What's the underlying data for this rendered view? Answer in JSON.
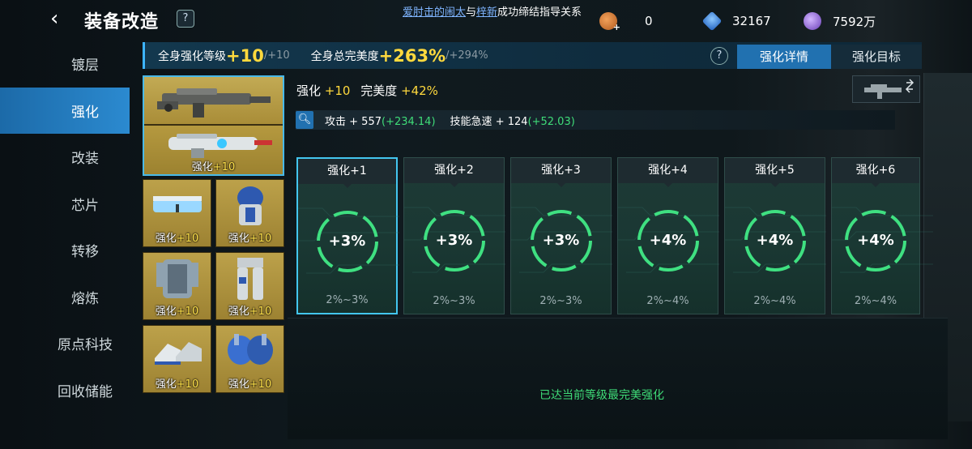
{
  "header": {
    "title": "装备改造",
    "help_label": "?",
    "ticker_parts": [
      "爱肘击的闹太",
      "与",
      "梓新",
      "成功缔结指导关系"
    ],
    "currencies": [
      {
        "icon": "bronze-medal-icon",
        "value": "0",
        "color": "#c8702a"
      },
      {
        "icon": "blue-crystal-icon",
        "value": "32167",
        "color": "#3a8de0"
      },
      {
        "icon": "purple-orb-icon",
        "value": "7592万",
        "color": "#9a6fe0"
      }
    ]
  },
  "nav": {
    "items": [
      "镀层",
      "强化",
      "改装",
      "芯片",
      "转移",
      "熔炼",
      "原点科技",
      "回收储能"
    ],
    "active_index": 1
  },
  "summary": {
    "level_label": "全身强化等级",
    "level_value": "+10",
    "level_max": "/+10",
    "perfect_label": "全身总完美度",
    "perfect_value": "+263%",
    "perfect_max": "/+294%",
    "help_label": "?"
  },
  "tabs": [
    "强化详情",
    "强化目标"
  ],
  "equipment": {
    "weapon_label": "强化",
    "weapon_level": "+10",
    "slots": [
      {
        "name": "goggles",
        "label": "强化",
        "level": "+10"
      },
      {
        "name": "helmet-chest",
        "label": "强化",
        "level": "+10"
      },
      {
        "name": "armor",
        "label": "强化",
        "level": "+10"
      },
      {
        "name": "legs",
        "label": "强化",
        "level": "+10"
      },
      {
        "name": "boots",
        "label": "强化",
        "level": "+10"
      },
      {
        "name": "gloves",
        "label": "强化",
        "level": "+10"
      }
    ]
  },
  "info": {
    "title": "强化",
    "level": "+10",
    "perfect_label": "完美度",
    "perfect_value": "+42%",
    "stats": [
      {
        "label": "攻击",
        "base": "+ 557",
        "bonus": "(+234.14)"
      },
      {
        "label": "技能急速",
        "base": "+ 124",
        "bonus": "(+52.03)"
      }
    ]
  },
  "cards": [
    {
      "title": "强化+1",
      "value": "+3%",
      "range": "2%~3%"
    },
    {
      "title": "强化+2",
      "value": "+3%",
      "range": "2%~3%"
    },
    {
      "title": "强化+3",
      "value": "+3%",
      "range": "2%~3%"
    },
    {
      "title": "强化+4",
      "value": "+4%",
      "range": "2%~4%"
    },
    {
      "title": "强化+5",
      "value": "+4%",
      "range": "2%~4%"
    },
    {
      "title": "强化+6",
      "value": "+4%",
      "range": "2%~4%"
    }
  ],
  "status_message": "已达当前等级最完美强化"
}
